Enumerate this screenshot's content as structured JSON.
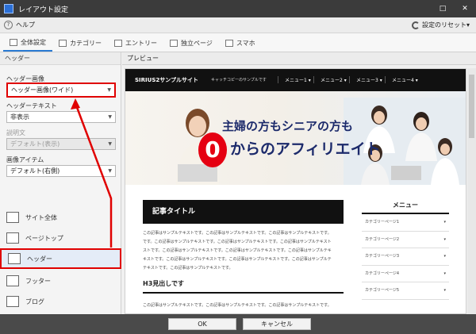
{
  "window": {
    "title": "レイアウト設定",
    "controls": [
      "□",
      "✕"
    ]
  },
  "menubar": {
    "help": "ヘルプ",
    "reset": "設定のリセット▾"
  },
  "tabs": [
    {
      "label": "全体設定",
      "active": true
    },
    {
      "label": "カテゴリー",
      "active": false
    },
    {
      "label": "エントリー",
      "active": false
    },
    {
      "label": "独立ページ",
      "active": false
    },
    {
      "label": "スマホ",
      "active": false
    }
  ],
  "left_panel": {
    "heading": "ヘッダー",
    "fields": [
      {
        "label": "ヘッダー画像",
        "value": "ヘッダー画像(ワイド)",
        "disabled": false,
        "highlight": true
      },
      {
        "label": "ヘッダーテキスト",
        "value": "非表示",
        "disabled": false,
        "highlight": false
      },
      {
        "label": "説明文",
        "value": "デフォルト(表示)",
        "disabled": true,
        "highlight": false
      },
      {
        "label": "画像アイテム",
        "value": "デフォルト(右側)",
        "disabled": false,
        "highlight": false
      }
    ],
    "nav": [
      {
        "label": "サイト全体",
        "selected": false
      },
      {
        "label": "ページトップ",
        "selected": false
      },
      {
        "label": "ヘッダー",
        "selected": true
      },
      {
        "label": "フッター",
        "selected": false
      },
      {
        "label": "ブログ",
        "selected": false
      }
    ]
  },
  "preview": {
    "heading": "プレビュー",
    "site_logo": "SIRIUS2サンプルサイト",
    "site_catch": "キャッチコピーのサンプルです",
    "menus": [
      "メニュー1 ▾",
      "メニュー2 ▾",
      "メニュー3 ▾",
      "メニュー4 ▾"
    ],
    "hero_line1": "主婦の方もシニアの方も",
    "hero_zero": "0",
    "hero_line2": "からのアフィリエイト",
    "article_title": "記事タイトル",
    "paragraph1": [
      "この記事はサンプルテキストです。この記事はサンプルテキストです。この記事はサンプルテキストです。",
      "です。この記事はサンプルテキストです。この記事はサンプルテキストです。この記事はサンプルテキスト",
      "ストです。この記事はサンプルテキストです。この記事はサンプルテキストです。この記事はサンプルテキ",
      "キストです。この記事はサンプルテキストです。この記事はサンプルテキストです。この記事はサンプルテ",
      "テキストです。この記事はサンプルテキストです。"
    ],
    "h3": "H3見出しです",
    "paragraph2": [
      "この記事はサンプルテキストです。この記事はサンプルテキストです。この記事はサンプルテキストです。"
    ],
    "widget_title": "メニュー",
    "widget_items": [
      "カテゴリーページ1",
      "カテゴリーページ2",
      "カテゴリーページ3",
      "カテゴリーページ4",
      "カテゴリーページ5"
    ],
    "widget_arrow": "▾"
  },
  "buttons": {
    "ok": "OK",
    "cancel": "キャンセル"
  },
  "colors": {
    "highlight": "#e00000",
    "accent": "#2a7ad2",
    "hero_text": "#1c2a6b",
    "zero_badge": "#e50012"
  }
}
